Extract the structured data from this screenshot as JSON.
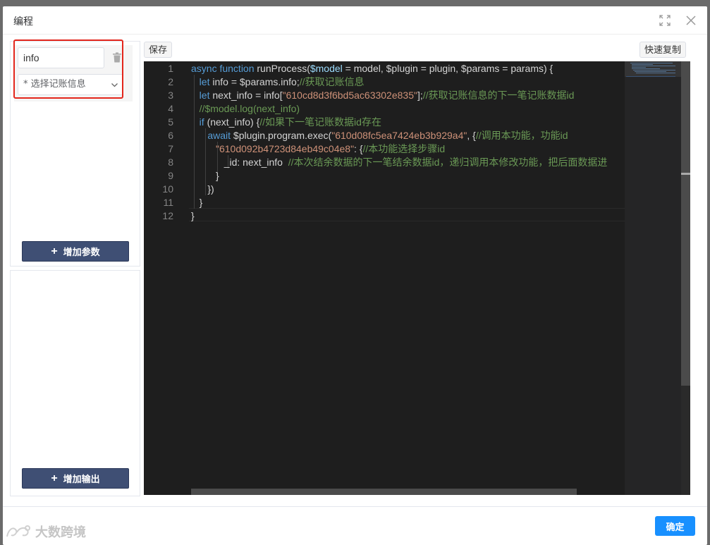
{
  "dialog": {
    "title": "编程",
    "confirm_label": "确定"
  },
  "params_panel": {
    "param_name": "info",
    "param_select_placeholder": "* 选择记账信息",
    "add_param_label": "增加参数"
  },
  "outputs_panel": {
    "add_output_label": "增加输出"
  },
  "toolbar": {
    "save_label": "保存",
    "copy_label": "快速复制"
  },
  "editor": {
    "line_numbers": [
      "1",
      "2",
      "3",
      "4",
      "5",
      "6",
      "7",
      "8",
      "9",
      "10",
      "11",
      "12"
    ],
    "lines": [
      [
        {
          "t": "async function ",
          "c": "k"
        },
        {
          "t": "runProcess(",
          "c": ""
        },
        {
          "t": "$model",
          "c": "v"
        },
        {
          "t": " = model, $plugin = plugin, $params = params) {",
          "c": ""
        }
      ],
      [
        {
          "t": "   ",
          "c": ""
        },
        {
          "t": "let ",
          "c": "k"
        },
        {
          "t": "info = $params.info;",
          "c": ""
        },
        {
          "t": "//获取记账信息",
          "c": "c"
        }
      ],
      [
        {
          "t": "   ",
          "c": ""
        },
        {
          "t": "let ",
          "c": "k"
        },
        {
          "t": "next_info = info[",
          "c": ""
        },
        {
          "t": "\"610cd8d3f6bd5ac63302e835\"",
          "c": "s"
        },
        {
          "t": "];",
          "c": ""
        },
        {
          "t": "//获取记账信息的下一笔记账数据id",
          "c": "c"
        }
      ],
      [
        {
          "t": "   ",
          "c": ""
        },
        {
          "t": "//$model.log(next_info)",
          "c": "c"
        }
      ],
      [
        {
          "t": "   ",
          "c": ""
        },
        {
          "t": "if ",
          "c": "k"
        },
        {
          "t": "(next_info) {",
          "c": ""
        },
        {
          "t": "//如果下一笔记账数据id存在",
          "c": "c"
        }
      ],
      [
        {
          "t": "      ",
          "c": ""
        },
        {
          "t": "await ",
          "c": "k"
        },
        {
          "t": "$plugin.program.exec(",
          "c": ""
        },
        {
          "t": "\"610d08fc5ea7424eb3b929a4\"",
          "c": "s"
        },
        {
          "t": ", {",
          "c": ""
        },
        {
          "t": "//调用本功能，功能id",
          "c": "c"
        }
      ],
      [
        {
          "t": "         ",
          "c": ""
        },
        {
          "t": "\"610d092b4723d84eb49c04e8\"",
          "c": "s"
        },
        {
          "t": ": {",
          "c": ""
        },
        {
          "t": "//本功能选择步骤id",
          "c": "c"
        }
      ],
      [
        {
          "t": "            ",
          "c": ""
        },
        {
          "t": "_id: next_info  ",
          "c": ""
        },
        {
          "t": "//本次结余数据的下一笔结余数据id，递归调用本修改功能，把后面数据进",
          "c": "c"
        }
      ],
      [
        {
          "t": "         }",
          "c": ""
        }
      ],
      [
        {
          "t": "      })",
          "c": ""
        }
      ],
      [
        {
          "t": "   }",
          "c": ""
        }
      ],
      [
        {
          "t": "}",
          "c": ""
        }
      ]
    ]
  },
  "watermark": {
    "text": "大数跨境"
  }
}
